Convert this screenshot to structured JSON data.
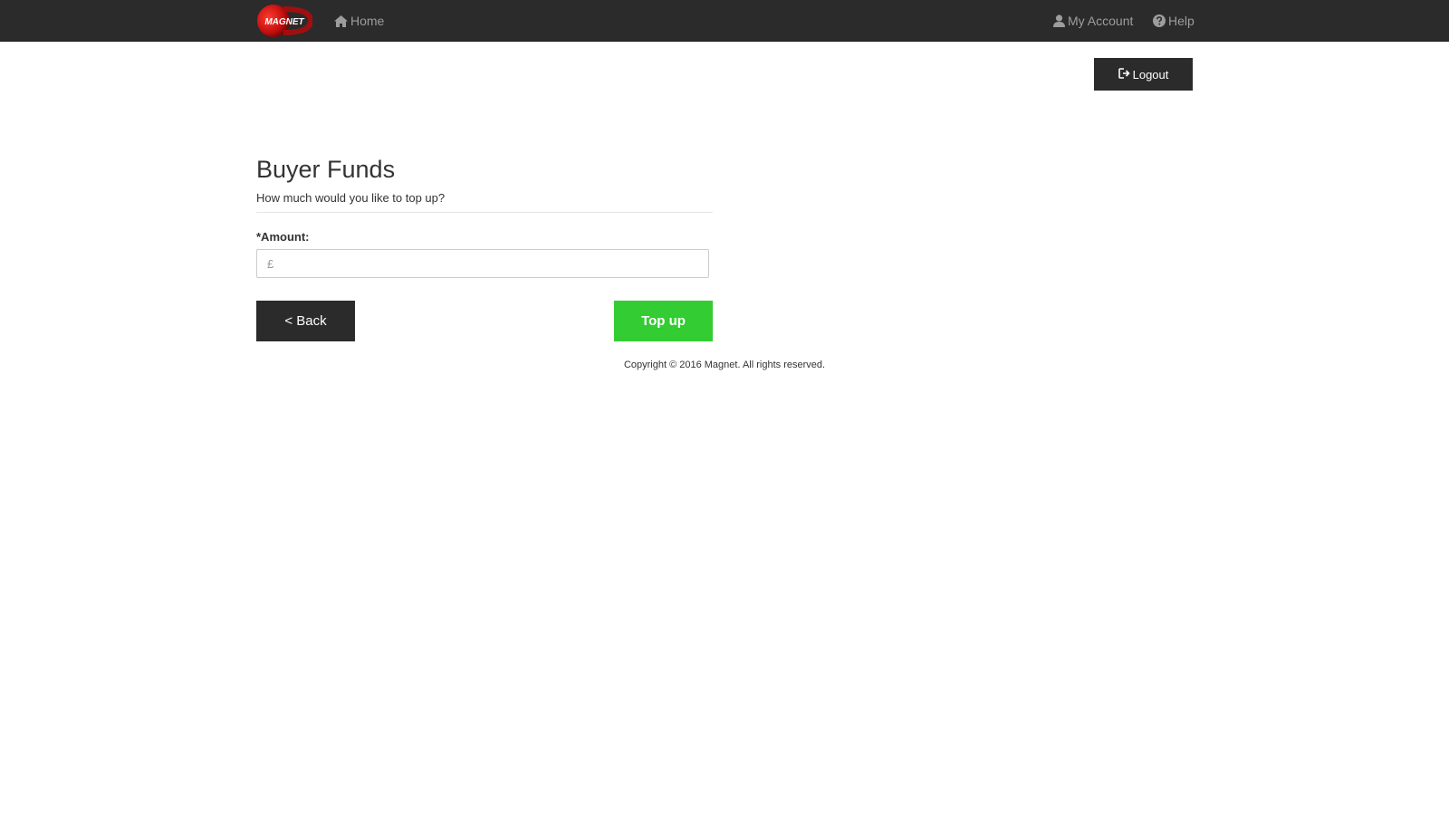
{
  "nav": {
    "logo_text": "MAGNET",
    "home_label": "Home",
    "home_icon": "home-icon",
    "account_label": "My Account",
    "account_icon": "user-icon",
    "help_label": "Help",
    "help_icon": "question-circle-icon"
  },
  "logout": {
    "label": "Logout",
    "icon": "sign-out-icon"
  },
  "main": {
    "title": "Buyer Funds",
    "subtitle": "How much would you like to top up?",
    "amount_label": "*Amount:",
    "amount_placeholder": "£",
    "amount_value": "",
    "back_label": "< Back",
    "topup_label": "Top up"
  },
  "footer": {
    "copyright": "Copyright © 2016 Magnet. All rights reserved."
  },
  "colors": {
    "navbar_bg": "#2b2b2b",
    "nav_text": "#9d9d9d",
    "topup_green": "#33cc33",
    "logo_red": "#cc1111"
  }
}
